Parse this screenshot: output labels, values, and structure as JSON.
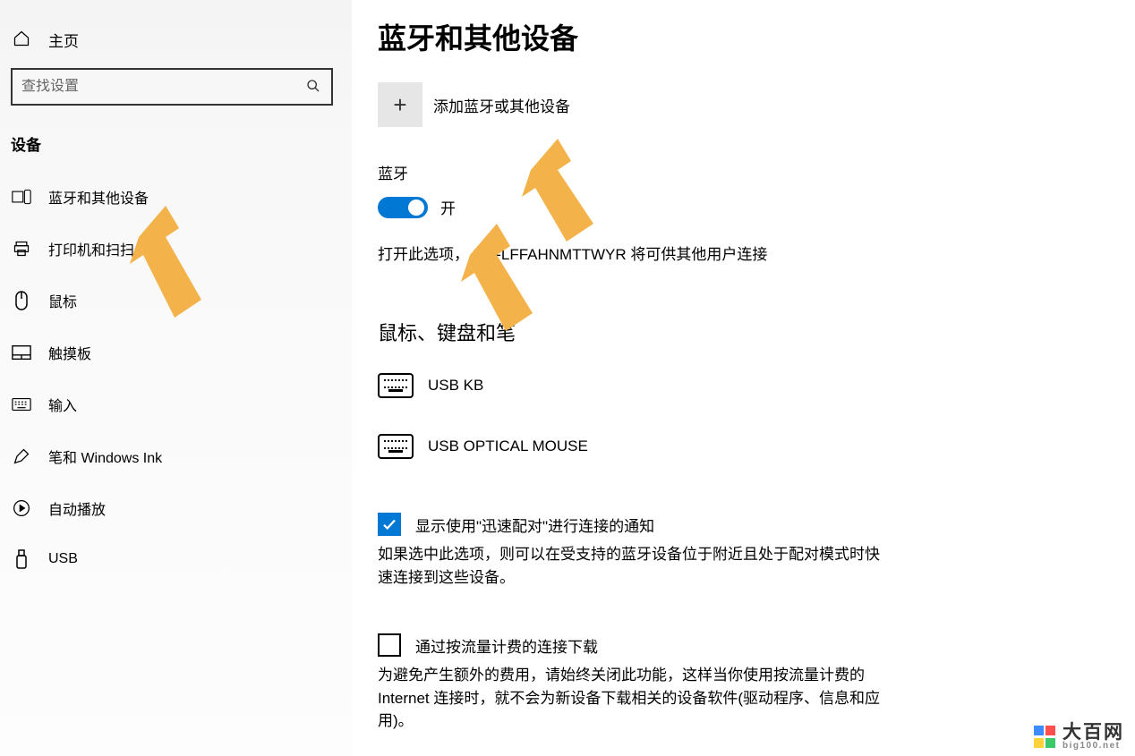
{
  "sidebar": {
    "home": "主页",
    "search_placeholder": "查找设置",
    "section": "设备",
    "items": [
      {
        "label": "蓝牙和其他设备"
      },
      {
        "label": "打印机和扫扫"
      },
      {
        "label": "鼠标"
      },
      {
        "label": "触摸板"
      },
      {
        "label": "输入"
      },
      {
        "label": "笔和 Windows Ink"
      },
      {
        "label": "自动播放"
      },
      {
        "label": "USB"
      }
    ]
  },
  "main": {
    "title": "蓝牙和其他设备",
    "add_label": "添加蓝牙或其他设备",
    "bt_heading": "蓝牙",
    "toggle_label": "开",
    "bt_desc": "打开此选项，          MS-LFFAHNMTTWYR 将可供其他用户连接",
    "section_mkp": "鼠标、键盘和笔",
    "devices": [
      {
        "name": "USB KB"
      },
      {
        "name": "USB OPTICAL MOUSE"
      }
    ],
    "chk1_label": "显示使用\"迅速配对\"进行连接的通知",
    "chk1_desc": "如果选中此选项，则可以在受支持的蓝牙设备位于附近且处于配对模式时快速连接到这些设备。",
    "chk2_label": "通过按流量计费的连接下载",
    "chk2_desc": "为避免产生额外的费用，请始终关闭此功能，这样当你使用按流量计费的 Internet 连接时，就不会为新设备下载相关的设备软件(驱动程序、信息和应用)。"
  },
  "watermark": {
    "name": "大百网",
    "url": "big100.net"
  }
}
